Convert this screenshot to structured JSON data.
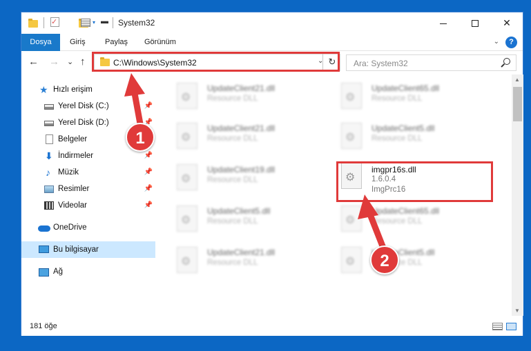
{
  "window": {
    "title": "System32",
    "controls": {
      "minimize": "—",
      "maximize": "☐",
      "close": "✕"
    }
  },
  "ribbon": {
    "tabs": [
      {
        "label": "Dosya",
        "active": true
      },
      {
        "label": "Giriş",
        "active": false
      },
      {
        "label": "Paylaş",
        "active": false
      },
      {
        "label": "Görünüm",
        "active": false
      }
    ],
    "help": "?"
  },
  "navigation": {
    "back": "←",
    "forward": "→",
    "recent": "⌄",
    "up": "↑",
    "address": "C:\\Windows\\System32",
    "refresh": "↻",
    "search_placeholder": "Ara: System32"
  },
  "sidebar": {
    "items": [
      {
        "label": "Hızlı erişim",
        "icon": "star-icon",
        "pinned": false
      },
      {
        "label": "Yerel Disk (C:)",
        "icon": "disk-icon",
        "pinned": true
      },
      {
        "label": "Yerel Disk (D:)",
        "icon": "disk-icon",
        "pinned": true
      },
      {
        "label": "Belgeler",
        "icon": "document-icon",
        "pinned": true
      },
      {
        "label": "İndirmeler",
        "icon": "download-icon",
        "pinned": true
      },
      {
        "label": "Müzik",
        "icon": "music-icon",
        "pinned": true
      },
      {
        "label": "Resimler",
        "icon": "pictures-icon",
        "pinned": true
      },
      {
        "label": "Videolar",
        "icon": "videos-icon",
        "pinned": true
      },
      {
        "label": "OneDrive",
        "icon": "cloud-icon",
        "pinned": false
      },
      {
        "label": "Bu bilgisayar",
        "icon": "pc-icon",
        "pinned": false,
        "selected": true
      },
      {
        "label": "Ağ",
        "icon": "network-icon",
        "pinned": false
      }
    ]
  },
  "files": {
    "left_column": [
      {
        "name": "UpdateClient21.dll",
        "description": "Resource DLL"
      },
      {
        "name": "UpdateClient21.dll",
        "description": "Resource DLL"
      },
      {
        "name": "UpdateClient19.dll",
        "description": "Resource DLL"
      },
      {
        "name": "UpdateClient5.dll",
        "description": "Resource DLL"
      },
      {
        "name": "UpdateClient21.dll",
        "description": "Resource DLL"
      }
    ],
    "right_column": [
      {
        "name": "UpdateClient65.dll",
        "description": "Resource DLL"
      },
      {
        "name": "UpdateClient5.dll",
        "description": "Resource DLL"
      },
      {
        "name": "UpdateClient65.dll",
        "description": "Resource DLL"
      },
      {
        "name": "UpdateClient5.dll",
        "description": "Resource DLL"
      }
    ],
    "highlighted": {
      "name": "imgpr16s.dll",
      "version": "1.6.0.4",
      "description": "ImgPrc16"
    }
  },
  "status": {
    "item_count": "181 öğe"
  },
  "annotations": {
    "badge_1": "1",
    "badge_2": "2",
    "color": "#e03a3a"
  }
}
